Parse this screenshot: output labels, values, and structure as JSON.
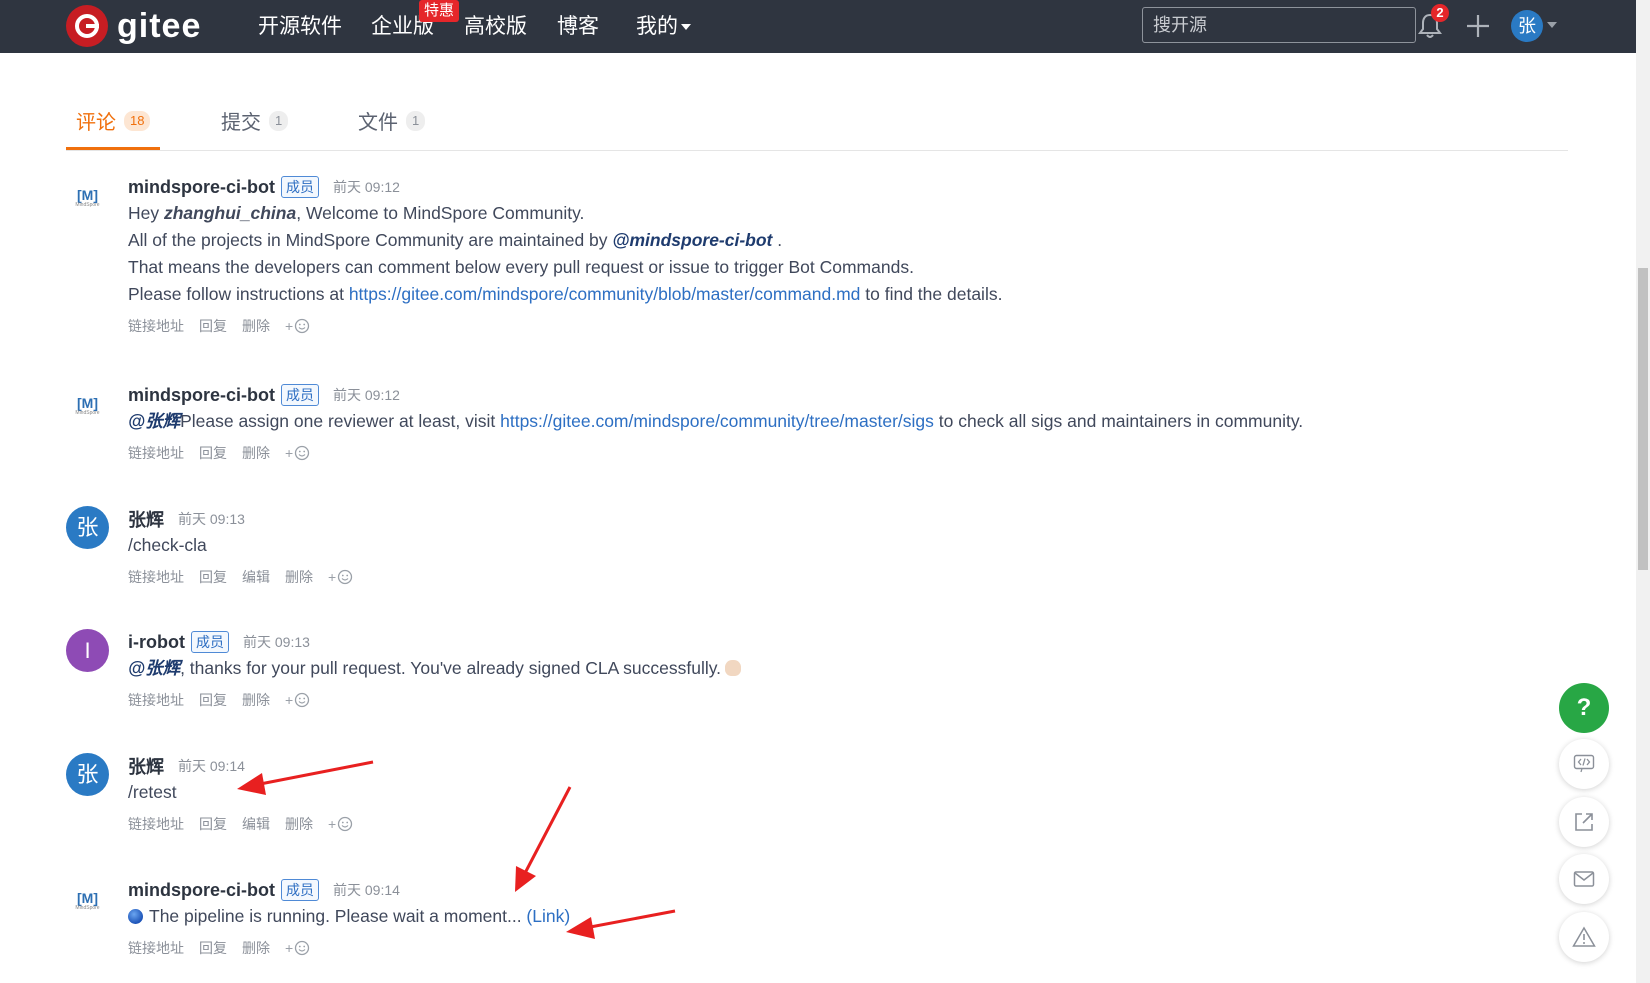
{
  "navbar": {
    "logo_text": "gitee",
    "items": [
      "开源软件",
      "企业版",
      "高校版",
      "博客",
      "我的"
    ],
    "promo_badge": "特惠",
    "search_placeholder": "搜开源",
    "notification_count": "2",
    "user_initial": "张"
  },
  "tabs": [
    {
      "label": "评论",
      "count": "18",
      "active": true
    },
    {
      "label": "提交",
      "count": "1",
      "active": false
    },
    {
      "label": "文件",
      "count": "1",
      "active": false
    }
  ],
  "bot_avatar": {
    "mark": "[M]",
    "sub": "MindSpore"
  },
  "comments": [
    {
      "author": "mindspore-ci-bot",
      "badge": "成员",
      "time": "前天 09:12",
      "line1": {
        "prefix": "Hey ",
        "name": "zhanghui_china",
        "suffix": ", Welcome to MindSpore Community."
      },
      "line2": {
        "prefix": "All of the projects in MindSpore Community are maintained by ",
        "mention": "@mindspore-ci-bot",
        "suffix": " ."
      },
      "line3": "That means the developers can comment below every pull request or issue to trigger Bot Commands.",
      "line4": {
        "prefix": "Please follow instructions at ",
        "link": "https://gitee.com/mindspore/community/blob/master/command.md",
        "suffix": " to find the details."
      },
      "actions": [
        "链接地址",
        "回复",
        "删除"
      ]
    },
    {
      "author": "mindspore-ci-bot",
      "badge": "成员",
      "time": "前天 09:12",
      "line1": {
        "mention": "@张辉",
        "prefix": "Please assign one reviewer at least, visit ",
        "link": "https://gitee.com/mindspore/community/tree/master/sigs",
        "suffix": " to check all sigs and maintainers in community."
      },
      "actions": [
        "链接地址",
        "回复",
        "删除"
      ]
    },
    {
      "author": "张辉",
      "avatar": "张",
      "time": "前天 09:13",
      "text": "/check-cla",
      "actions": [
        "链接地址",
        "回复",
        "编辑",
        "删除"
      ]
    },
    {
      "author": "i-robot",
      "avatar": "I",
      "badge": "成员",
      "time": "前天 09:13",
      "line1": {
        "mention": "@张辉",
        "suffix": ", thanks for your pull request. You've already signed CLA successfully."
      },
      "actions": [
        "链接地址",
        "回复",
        "删除"
      ]
    },
    {
      "author": "张辉",
      "avatar": "张",
      "time": "前天 09:14",
      "text": "/retest",
      "actions": [
        "链接地址",
        "回复",
        "编辑",
        "删除"
      ]
    },
    {
      "author": "mindspore-ci-bot",
      "badge": "成员",
      "time": "前天 09:14",
      "line1": {
        "text": "The pipeline is running. Please wait a moment... ",
        "link": "(Link)"
      },
      "actions": [
        "链接地址",
        "回复",
        "删除"
      ]
    }
  ],
  "reaction_plus": "+",
  "help_button": "?",
  "colors": {
    "accent": "#f0700d",
    "navbar": "#2f3540",
    "link": "#2d6fc3",
    "annotation": "#e82020"
  }
}
